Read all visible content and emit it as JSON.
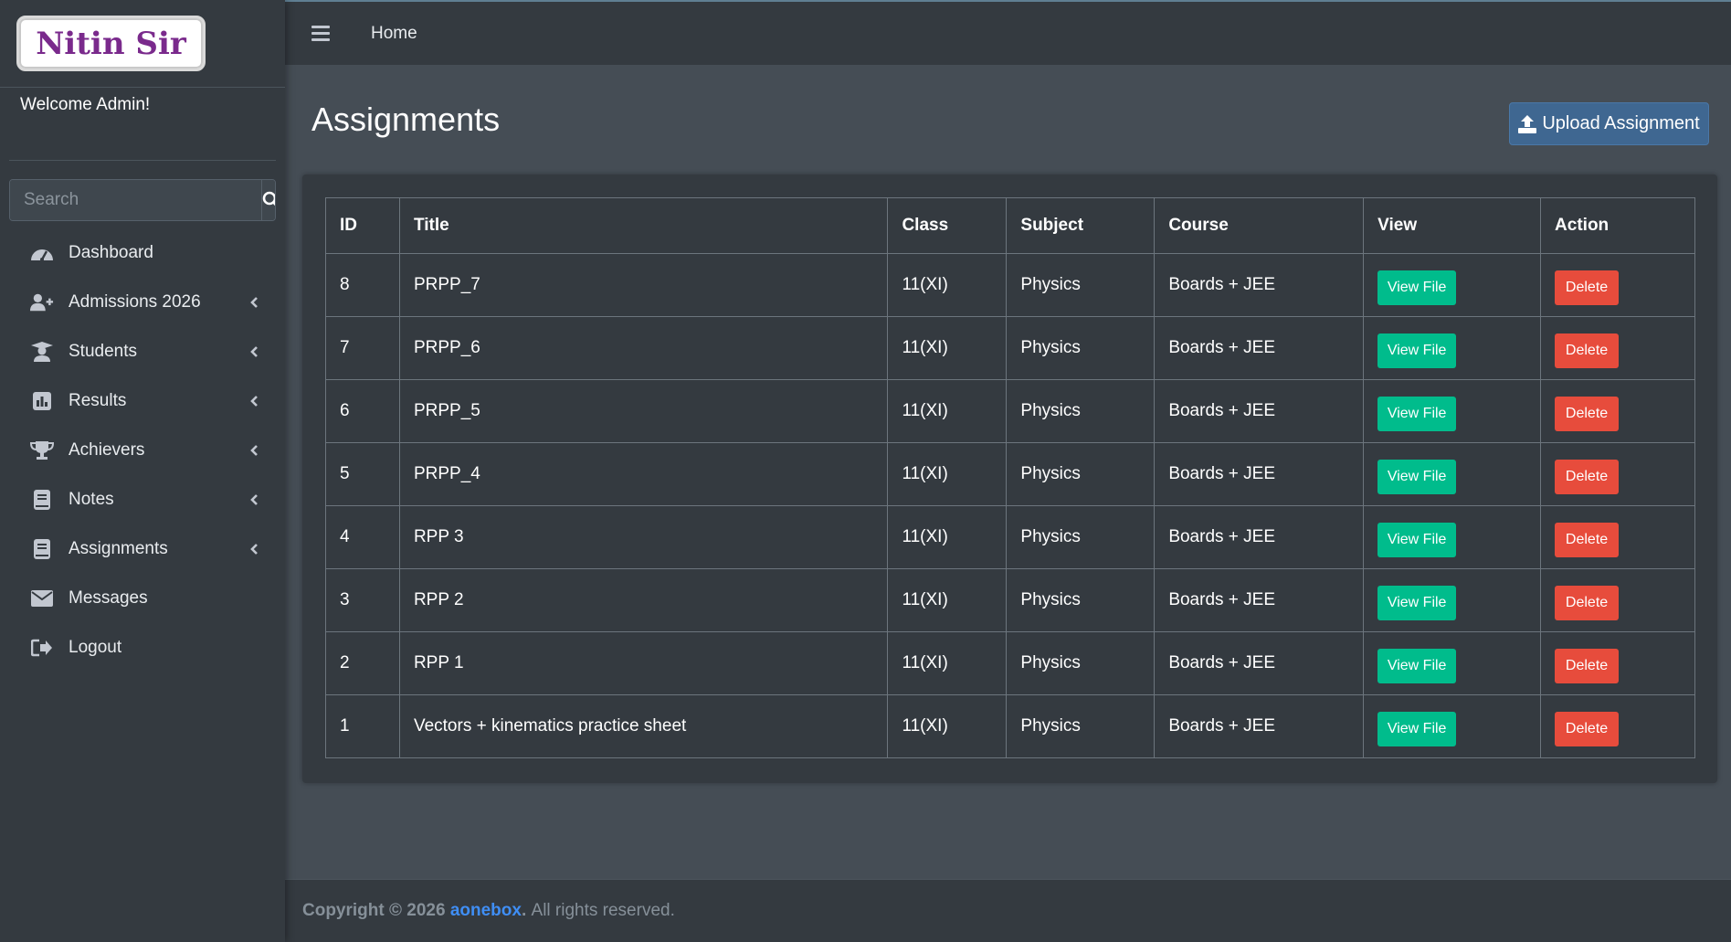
{
  "brand": {
    "logo_text": "Nitin Sir"
  },
  "sidebar": {
    "welcome": "Welcome Admin!",
    "search_placeholder": "Search",
    "items": [
      {
        "label": "Dashboard",
        "icon": "dashboard-icon",
        "has_arrow": false
      },
      {
        "label": "Admissions 2026",
        "icon": "user-plus-icon",
        "has_arrow": true
      },
      {
        "label": "Students",
        "icon": "student-icon",
        "has_arrow": true
      },
      {
        "label": "Results",
        "icon": "chart-icon",
        "has_arrow": true
      },
      {
        "label": "Achievers",
        "icon": "trophy-icon",
        "has_arrow": true
      },
      {
        "label": "Notes",
        "icon": "book-icon",
        "has_arrow": true
      },
      {
        "label": "Assignments",
        "icon": "book-icon",
        "has_arrow": true
      },
      {
        "label": "Messages",
        "icon": "envelope-icon",
        "has_arrow": false
      },
      {
        "label": "Logout",
        "icon": "logout-icon",
        "has_arrow": false
      }
    ]
  },
  "topbar": {
    "home_label": "Home"
  },
  "main": {
    "title": "Assignments",
    "upload_label": "Upload Assignment"
  },
  "table": {
    "headers": [
      "ID",
      "Title",
      "Class",
      "Subject",
      "Course",
      "View",
      "Action"
    ],
    "view_label": "View File",
    "delete_label": "Delete",
    "rows": [
      {
        "id": "8",
        "title": "PRPP_7",
        "class": "11(XI)",
        "subject": "Physics",
        "course": "Boards + JEE"
      },
      {
        "id": "7",
        "title": "PRPP_6",
        "class": "11(XI)",
        "subject": "Physics",
        "course": "Boards + JEE"
      },
      {
        "id": "6",
        "title": "PRPP_5",
        "class": "11(XI)",
        "subject": "Physics",
        "course": "Boards + JEE"
      },
      {
        "id": "5",
        "title": "PRPP_4",
        "class": "11(XI)",
        "subject": "Physics",
        "course": "Boards + JEE"
      },
      {
        "id": "4",
        "title": "RPP 3",
        "class": "11(XI)",
        "subject": "Physics",
        "course": "Boards + JEE"
      },
      {
        "id": "3",
        "title": "RPP 2",
        "class": "11(XI)",
        "subject": "Physics",
        "course": "Boards + JEE"
      },
      {
        "id": "2",
        "title": "RPP 1",
        "class": "11(XI)",
        "subject": "Physics",
        "course": "Boards + JEE"
      },
      {
        "id": "1",
        "title": "Vectors + kinematics practice sheet",
        "class": "11(XI)",
        "subject": "Physics",
        "course": "Boards + JEE"
      }
    ]
  },
  "footer": {
    "copyright": "Copyright © 2026",
    "brand": "aonebox",
    "period": ".",
    "rights": "All rights reserved."
  },
  "colors": {
    "sidebar_bg": "#343a40",
    "content_bg": "#454d55",
    "primary": "#3f6791",
    "success": "#00bc8c",
    "danger": "#e74c3c",
    "link": "#3f8ef5"
  }
}
